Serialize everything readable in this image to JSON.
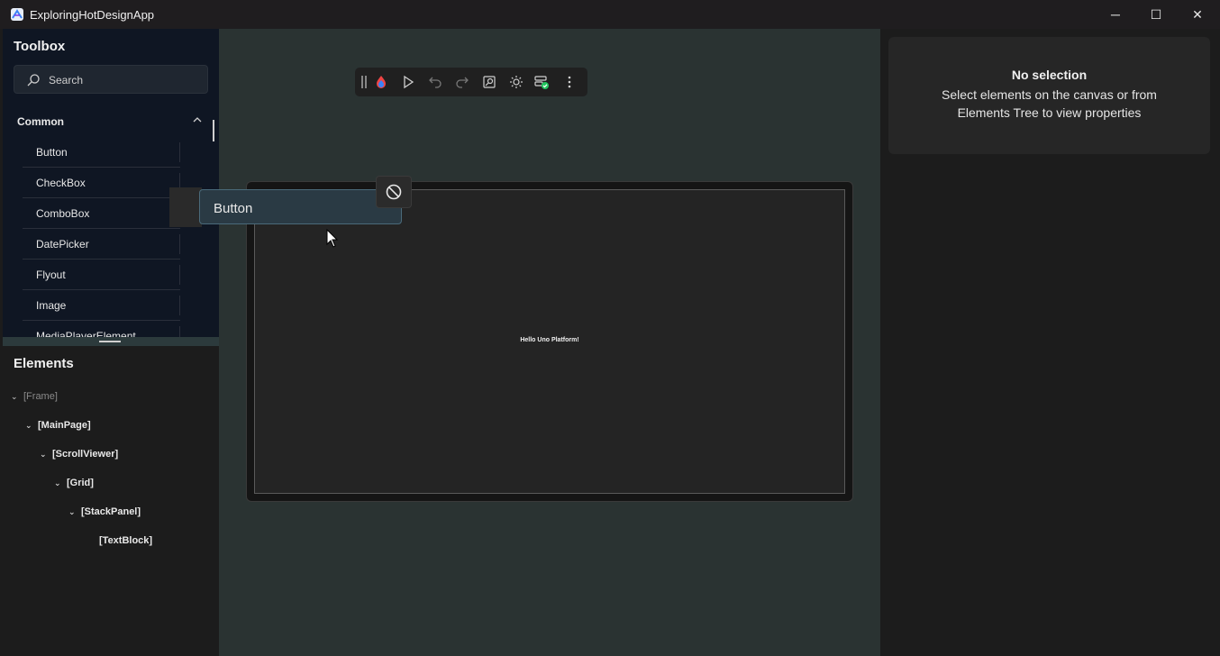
{
  "window": {
    "title": "ExploringHotDesignApp",
    "minimize": "─",
    "maximize": "☐",
    "close": "✕"
  },
  "toolbox": {
    "title": "Toolbox",
    "search_placeholder": "Search",
    "section": "Common",
    "items": [
      "Button",
      "CheckBox",
      "ComboBox",
      "DatePicker",
      "Flyout",
      "Image",
      "MediaPlayerElement"
    ]
  },
  "elements": {
    "title": "Elements",
    "tree": [
      {
        "label": "[Frame]",
        "chevron": "❯",
        "depth": 0
      },
      {
        "label": "[MainPage]",
        "chevron": "❯",
        "depth": 1
      },
      {
        "label": "[ScrollViewer]",
        "chevron": "❯",
        "depth": 2
      },
      {
        "label": "[Grid]",
        "chevron": "❯",
        "depth": 3
      },
      {
        "label": "[StackPanel]",
        "chevron": "❯",
        "depth": 4
      },
      {
        "label": "[TextBlock]",
        "chevron": "",
        "depth": 5
      }
    ]
  },
  "canvas": {
    "hello_text": "Hello Uno Platform!",
    "drag_ghost_label": "Button"
  },
  "toolbar": {
    "icons": [
      "grip-icon",
      "hot-design-icon",
      "play-icon",
      "undo-icon",
      "redo-icon",
      "zoom-fit-icon",
      "theme-icon",
      "hot-reload-status-icon",
      "more-options-icon"
    ]
  },
  "properties": {
    "title": "No selection",
    "description": "Select elements on the canvas or from Elements Tree to view properties"
  },
  "colors": {
    "accent": "#3b82f6",
    "canvas_bg": "#2a3332",
    "toolbox_bg": "#0f1623",
    "status_ok": "#22c55e"
  }
}
